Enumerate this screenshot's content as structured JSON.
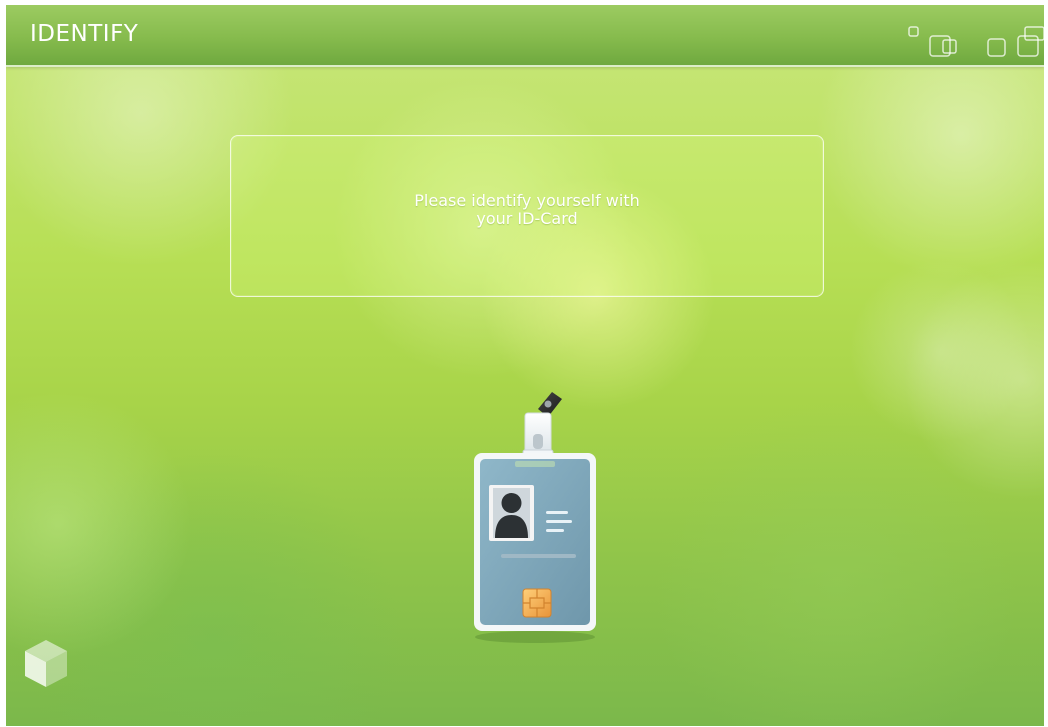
{
  "header": {
    "title": "IDENTIFY",
    "decor_icon_name": "window-squares-icon"
  },
  "message": {
    "line1": "Please identify yourself with",
    "line2": "your ID-Card"
  },
  "illustration": {
    "icon_name": "id-card-icon"
  },
  "branding": {
    "icon_name": "cube-logo-icon"
  },
  "colors": {
    "header_green": "#86bb4d",
    "background_green": "#b7df55",
    "card_blue": "#7aa2b8",
    "chip_orange": "#f0a64a"
  }
}
